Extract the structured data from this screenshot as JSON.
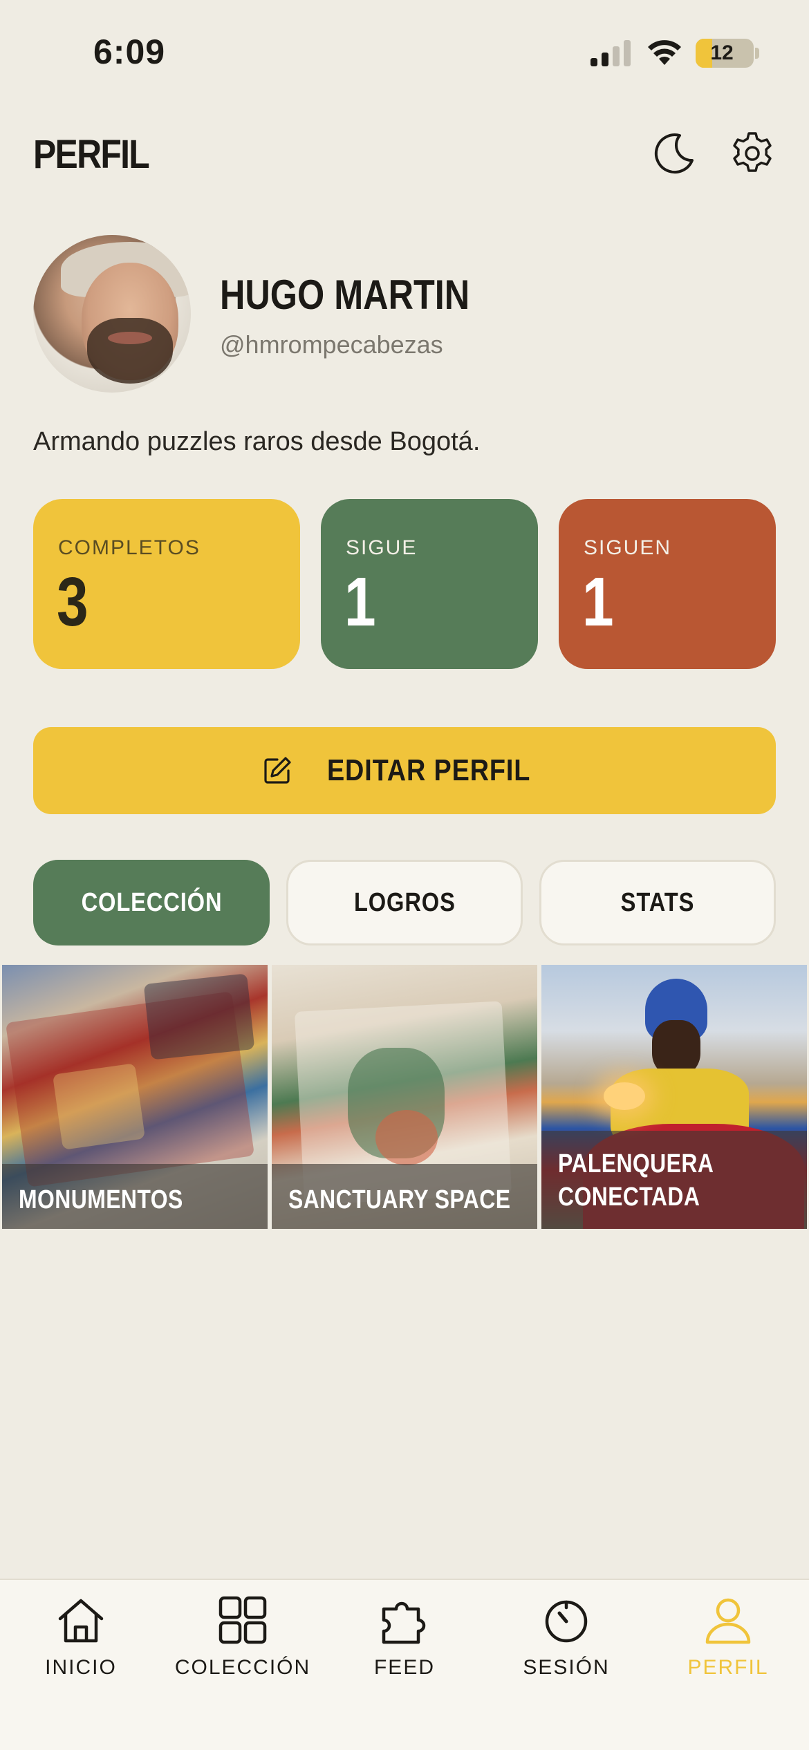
{
  "status_bar": {
    "time": "6:09",
    "battery": "12"
  },
  "header": {
    "title": "PERFIL"
  },
  "profile": {
    "name": "HUGO MARTIN",
    "handle": "@hmrompecabezas",
    "bio": "Armando puzzles raros desde Bogotá."
  },
  "stats": [
    {
      "label": "COMPLETOS",
      "value": "3",
      "color": "#f0c43b"
    },
    {
      "label": "SIGUE",
      "value": "1",
      "color": "#567c58"
    },
    {
      "label": "SIGUEN",
      "value": "1",
      "color": "#b95733"
    }
  ],
  "edit_button": {
    "label": "EDITAR PERFIL"
  },
  "tabs": [
    {
      "label": "COLECCIÓN",
      "active": true
    },
    {
      "label": "LOGROS",
      "active": false
    },
    {
      "label": "STATS",
      "active": false
    }
  ],
  "collection": [
    {
      "title": "MONUMENTOS"
    },
    {
      "title_line1": "SANCTUARY SPACE"
    },
    {
      "title_line1": "PALENQUERA",
      "title_line2": "CONECTADA"
    }
  ],
  "bottom_nav": [
    {
      "label": "INICIO",
      "icon": "home-icon"
    },
    {
      "label": "COLECCIÓN",
      "icon": "grid-icon"
    },
    {
      "label": "FEED",
      "icon": "puzzle-piece-icon"
    },
    {
      "label": "SESIÓN",
      "icon": "timer-icon"
    },
    {
      "label": "PERFIL",
      "icon": "user-icon",
      "active": true
    }
  ],
  "colors": {
    "background": "#efece3",
    "accent_yellow": "#f0c43b",
    "green": "#567c58",
    "rust": "#b95733"
  }
}
